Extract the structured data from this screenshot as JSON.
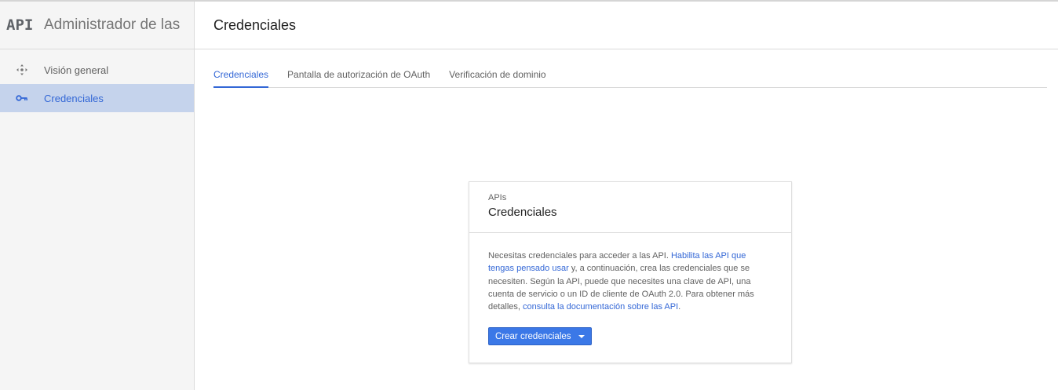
{
  "sidebar": {
    "logo": "API",
    "app_title": "Administrador de las APIs",
    "items": [
      {
        "label": "Visión general",
        "icon": "overview-icon",
        "active": false
      },
      {
        "label": "Credenciales",
        "icon": "key-icon",
        "active": true
      }
    ]
  },
  "header": {
    "title": "Credenciales"
  },
  "tabs": [
    {
      "label": "Credenciales",
      "active": true
    },
    {
      "label": "Pantalla de autorización de OAuth",
      "active": false
    },
    {
      "label": "Verificación de dominio",
      "active": false
    }
  ],
  "card": {
    "kicker": "APIs",
    "title": "Credenciales",
    "body": {
      "text1": "Necesitas credenciales para acceder a las API. ",
      "link1": "Habilita las API que tengas pensado usar",
      "text2": " y, a continuación, crea las credenciales que se necesiten. Según la API, puede que necesites una clave de API, una cuenta de servicio o un ID de cliente de OAuth 2.0. Para obtener más detalles, ",
      "link2": "consulta la documentación sobre las API",
      "text3": "."
    },
    "button_label": "Crear credenciales"
  },
  "colors": {
    "accent": "#3367d6",
    "button": "#3b78e7",
    "active_nav_bg": "#c5d3ec",
    "sidebar_bg": "#f5f5f5"
  }
}
